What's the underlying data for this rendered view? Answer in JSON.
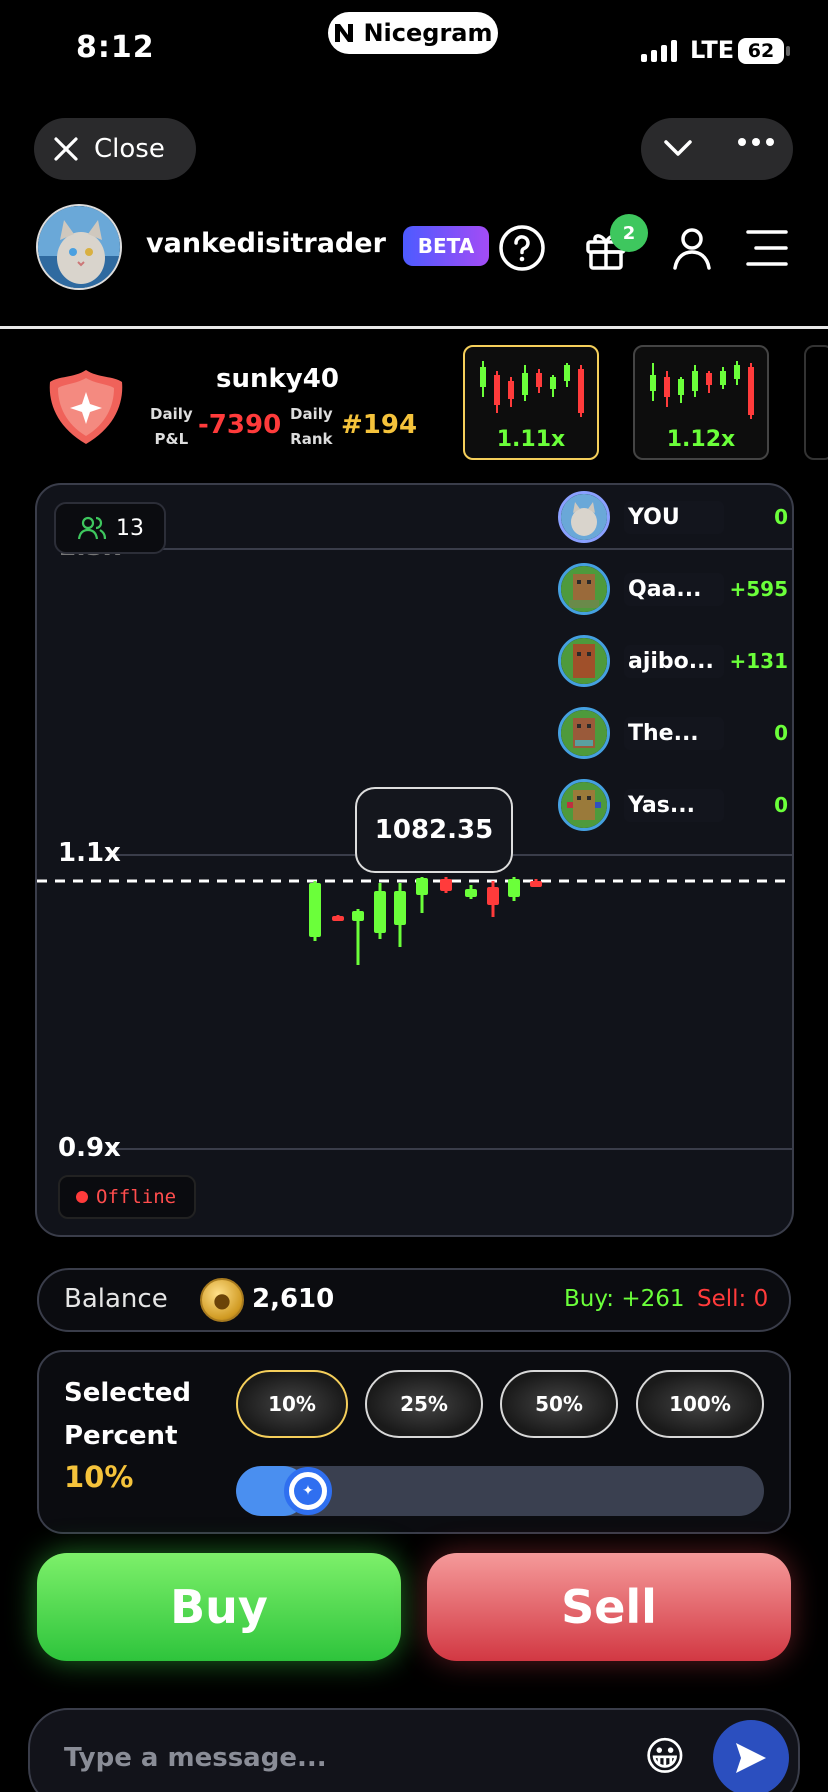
{
  "status_bar": {
    "time": "8:12",
    "app_pill": "Nicegram",
    "network": "LTE",
    "battery": "62"
  },
  "nav": {
    "close_label": "Close"
  },
  "header": {
    "username": "vankedisitrader",
    "beta_label": "BETA",
    "gift_badge": "2"
  },
  "profile": {
    "name": "sunky40",
    "pnl_label_1": "Daily",
    "pnl_label_2": "P&L",
    "pnl_value": "-7390",
    "rank_label_1": "Daily",
    "rank_label_2": "Rank",
    "rank_value": "#194"
  },
  "mini_charts": [
    {
      "label": "1.11x",
      "selected": true
    },
    {
      "label": "1.12x",
      "selected": false
    }
  ],
  "chart": {
    "viewers": "13",
    "current_price": "1082.35",
    "status": "Offline",
    "axis_labels": {
      "top": "1.3x",
      "mid": "1.1x",
      "bottom": "0.9x"
    }
  },
  "chart_data": {
    "type": "candlestick",
    "y_axis_ticks": [
      "1.3x",
      "1.1x",
      "0.9x"
    ],
    "current_price_label": "1082.35",
    "candles": [
      {
        "direction": "up"
      },
      {
        "direction": "down"
      },
      {
        "direction": "up"
      },
      {
        "direction": "up"
      },
      {
        "direction": "up"
      },
      {
        "direction": "up"
      },
      {
        "direction": "down"
      },
      {
        "direction": "up"
      },
      {
        "direction": "down"
      },
      {
        "direction": "up"
      },
      {
        "direction": "down"
      }
    ]
  },
  "leaderboard": [
    {
      "name": "YOU",
      "score": "0"
    },
    {
      "name": "Qaa...",
      "score": "+595"
    },
    {
      "name": "ajibo...",
      "score": "+131"
    },
    {
      "name": "The...",
      "score": "0"
    },
    {
      "name": "Yas...",
      "score": "0"
    }
  ],
  "balance": {
    "label": "Balance",
    "value": "2,610",
    "buy": "Buy: +261",
    "sell": "Sell: 0"
  },
  "percent": {
    "label": "Selected Percent",
    "value": "10%",
    "options": [
      "10%",
      "25%",
      "50%",
      "100%"
    ],
    "slider_fraction": 0.1
  },
  "actions": {
    "buy": "Buy",
    "sell": "Sell"
  },
  "message": {
    "placeholder": "Type a message..."
  },
  "colors": {
    "green": "#6bff3a",
    "red": "#ff3b3b",
    "gold": "#f5c33b",
    "accent": "#4a8ff0"
  }
}
